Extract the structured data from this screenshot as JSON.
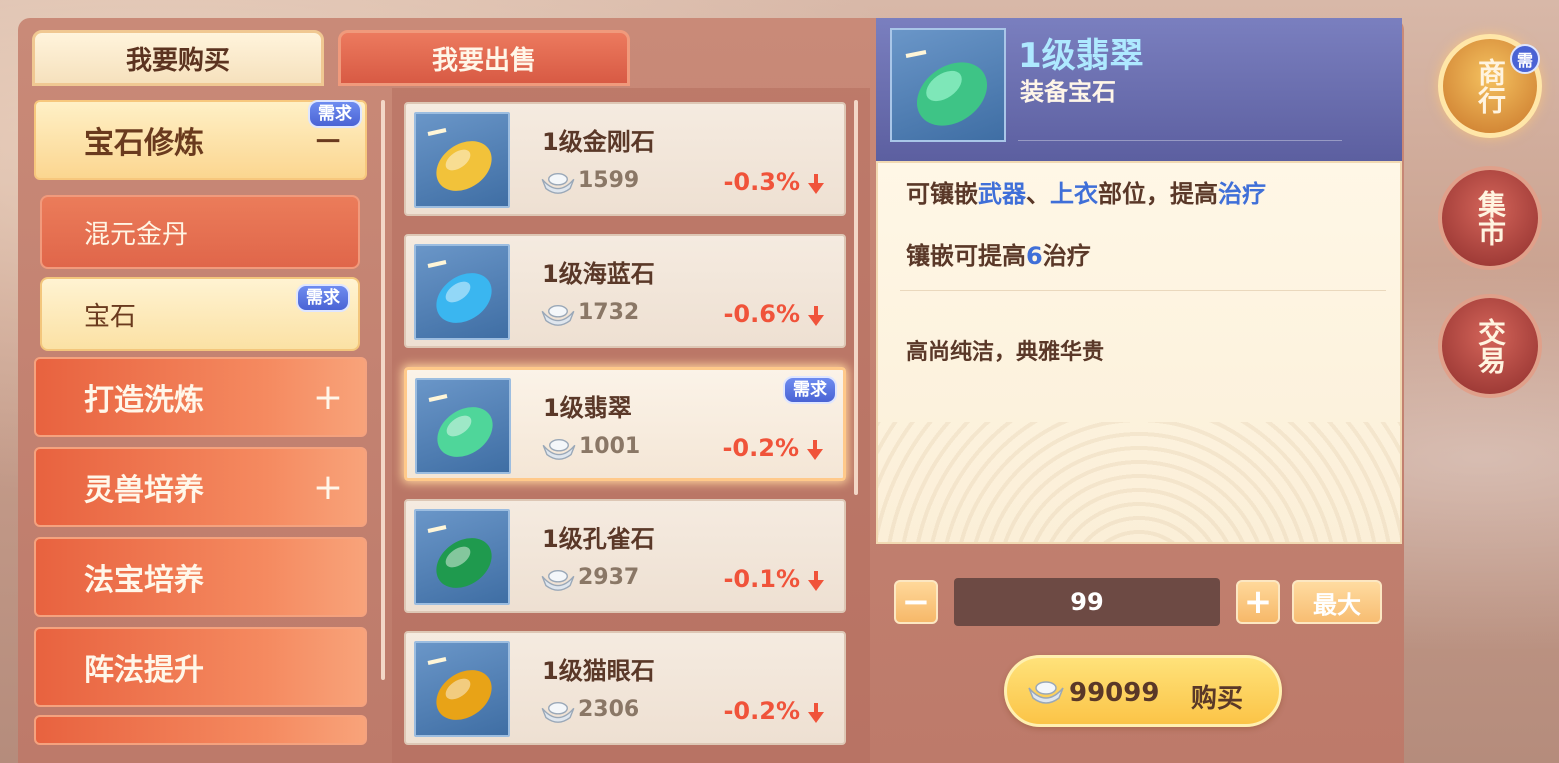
{
  "tabs": {
    "buy": "我要购买",
    "sell": "我要出售"
  },
  "categories": [
    {
      "label": "宝石修炼",
      "sign": "−",
      "badge": "需求"
    },
    {
      "label": "打造洗炼",
      "sign": "+"
    },
    {
      "label": "灵兽培养",
      "sign": "+"
    },
    {
      "label": "法宝培养"
    },
    {
      "label": "阵法提升"
    }
  ],
  "subcategories": [
    {
      "label": "混元金丹"
    },
    {
      "label": "宝石",
      "badge": "需求"
    }
  ],
  "items": [
    {
      "name": "1级金刚石",
      "price": "1599",
      "change": "-0.3%",
      "color": "#f2c23a"
    },
    {
      "name": "1级海蓝石",
      "price": "1732",
      "change": "-0.6%",
      "color": "#3ab6f0"
    },
    {
      "name": "1级翡翠",
      "price": "1001",
      "change": "-0.2%",
      "color": "#4fd69a",
      "badge": "需求"
    },
    {
      "name": "1级孔雀石",
      "price": "2937",
      "change": "-0.1%",
      "color": "#1f9a4e"
    },
    {
      "name": "1级猫眼石",
      "price": "2306",
      "change": "-0.2%",
      "color": "#e8a317"
    }
  ],
  "detail": {
    "title": "1级翡翠",
    "subtitle": "装备宝石",
    "line1": {
      "a": "可镶嵌",
      "b": "武器",
      "c": "、",
      "d": "上衣",
      "e": "部位，提高",
      "f": "治疗"
    },
    "line2": {
      "a": "镶嵌可提高",
      "b": "6",
      "c": "治疗"
    },
    "flavor": "高尚纯洁，典雅华贵"
  },
  "quantity": {
    "value": "99",
    "minus": "−",
    "plus": "+",
    "max_label": "最大"
  },
  "buy": {
    "cost": "99099",
    "label": "购买"
  },
  "side": {
    "shop": "商行",
    "shop_badge": "需",
    "market": "集市",
    "trade": "交易"
  }
}
